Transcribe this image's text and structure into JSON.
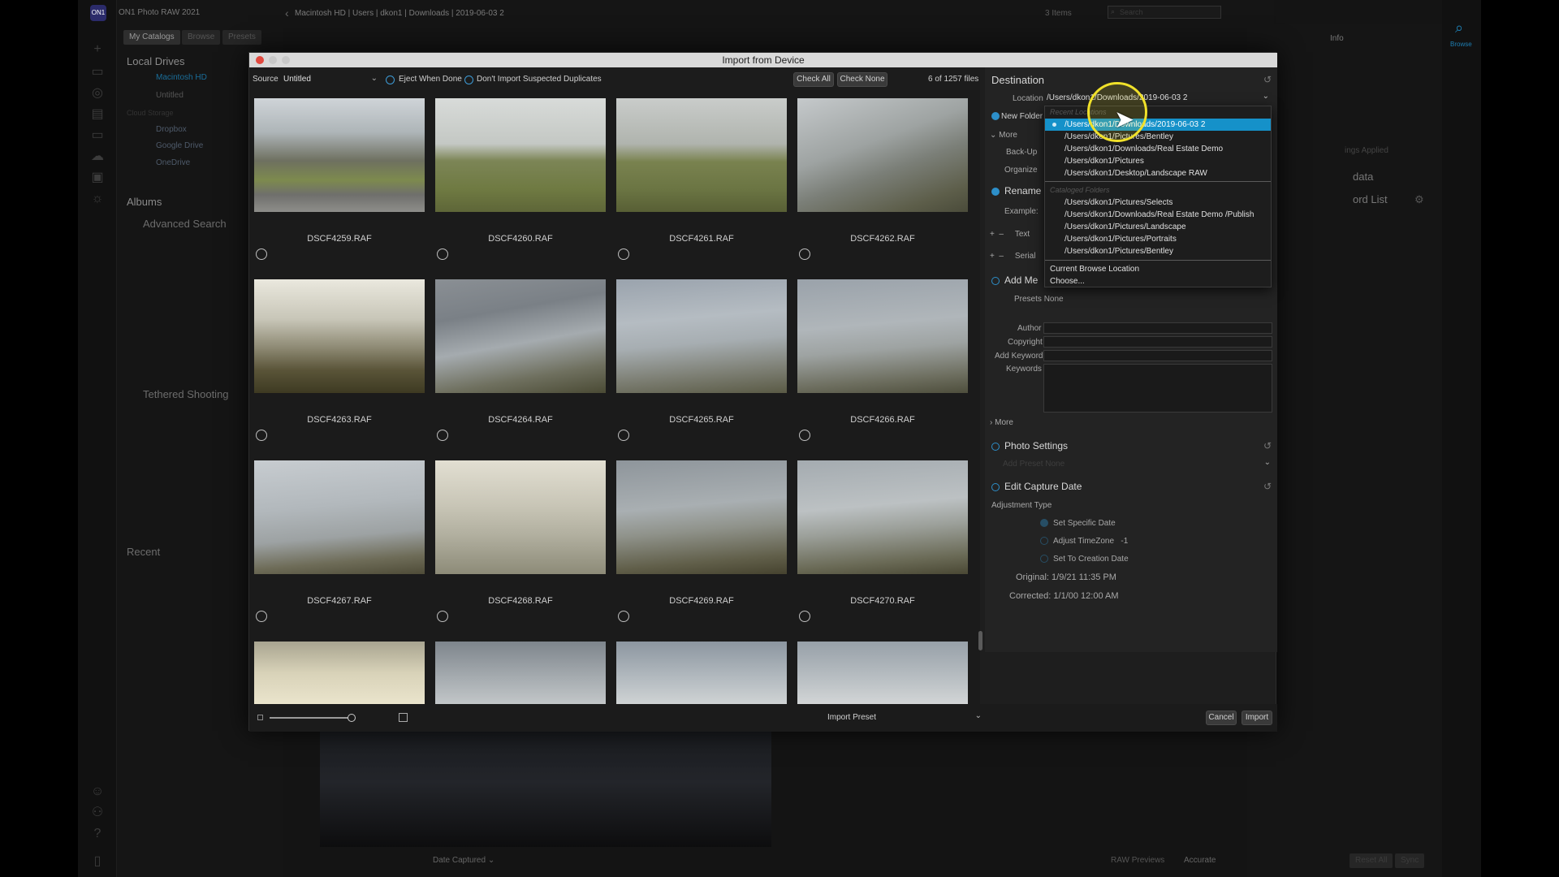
{
  "app": {
    "title": "ON1 Photo RAW 2021"
  },
  "topbar": {
    "path": [
      "Macintosh HD",
      "Users",
      "dkon1",
      "Downloads",
      "2019-06-03 2"
    ],
    "items_count": "3 Items",
    "search_placeholder": "Search"
  },
  "left_panel": {
    "tabs": [
      "My Catalogs",
      "Browse",
      "Presets"
    ],
    "local_drives_title": "Local Drives",
    "drives": [
      "Macintosh HD",
      "Untitled"
    ],
    "cloud_title": "Cloud Storage",
    "cloud": [
      "Dropbox",
      "Google Drive",
      "OneDrive"
    ],
    "albums_title": "Albums",
    "advanced_search": "Advanced Search",
    "tethered": "Tethered Shooting",
    "recent": "Recent"
  },
  "right_panel": {
    "info_tab": "Info",
    "settings_applied": "ings Applied",
    "metadata": "data",
    "keyword_list": "ord List"
  },
  "right_strip": {
    "browse": "Browse"
  },
  "bottom_app": {
    "sort": "Date Captured",
    "raw_previews_label": "RAW Previews",
    "raw_previews_value": "Accurate",
    "reset_all": "Reset All",
    "sync": "Sync"
  },
  "dialog": {
    "title": "Import from Device",
    "source_label": "Source",
    "source_value": "Untitled",
    "eject_label": "Eject When Done",
    "duplicates_label": "Don't Import Suspected Duplicates",
    "check_all": "Check All",
    "check_none": "Check None",
    "file_count": "6 of 1257 files",
    "import_preset": "Import Preset",
    "cancel": "Cancel",
    "import": "Import",
    "thumbnails": [
      {
        "name": "DSCF4259.RAF"
      },
      {
        "name": "DSCF4260.RAF"
      },
      {
        "name": "DSCF4261.RAF"
      },
      {
        "name": "DSCF4262.RAF"
      },
      {
        "name": "DSCF4263.RAF"
      },
      {
        "name": "DSCF4264.RAF"
      },
      {
        "name": "DSCF4265.RAF"
      },
      {
        "name": "DSCF4266.RAF"
      },
      {
        "name": "DSCF4267.RAF"
      },
      {
        "name": "DSCF4268.RAF"
      },
      {
        "name": "DSCF4269.RAF"
      },
      {
        "name": "DSCF4270.RAF"
      }
    ]
  },
  "destination": {
    "title": "Destination",
    "location_label": "Location",
    "location_value": "/Users/dkon1/Downloads/2019-06-03 2",
    "new_folder": "New Folder",
    "more": "More",
    "backup": "Back-Up",
    "organize": "Organize",
    "rename": "Rename",
    "example": "Example:",
    "text": "Text",
    "serial": "Serial",
    "add_metadata": "Add Me",
    "presets_label": "Presets",
    "presets_value": "None",
    "author": "Author",
    "copyright": "Copyright",
    "add_keyword": "Add Keyword",
    "keywords": "Keywords",
    "more2": "More",
    "photo_settings": "Photo Settings",
    "add_preset_label": "Add Preset",
    "add_preset_value": "None",
    "edit_capture_date": "Edit Capture Date",
    "adjustment_type": "Adjustment Type",
    "set_specific_date": "Set Specific Date",
    "adjust_timezone": "Adjust TimeZone",
    "timezone_value": "-1",
    "set_to_creation": "Set To Creation Date",
    "original_label": "Original:",
    "original_value": "1/9/21 11:35 PM",
    "corrected_label": "Corrected:",
    "corrected_value": "1/1/00 12:00 AM"
  },
  "dropdown": {
    "recent_header": "Recent Locations",
    "recent": [
      "/Users/dkon1/Downloads/2019-06-03 2",
      "/Users/dkon1/Pictures/Bentley",
      "/Users/dkon1/Downloads/Real Estate Demo",
      "/Users/dkon1/Pictures",
      "/Users/dkon1/Desktop/Landscape RAW"
    ],
    "cataloged_header": "Cataloged Folders",
    "cataloged": [
      "/Users/dkon1/Pictures/Selects",
      "/Users/dkon1/Downloads/Real Estate Demo /Publish",
      "/Users/dkon1/Pictures/Landscape",
      "/Users/dkon1/Pictures/Portraits",
      "/Users/dkon1/Pictures/Bentley"
    ],
    "current_browse": "Current Browse Location",
    "choose": "Choose..."
  },
  "colors": {
    "accent": "#1e9ad6",
    "selection": "#1591c9"
  }
}
